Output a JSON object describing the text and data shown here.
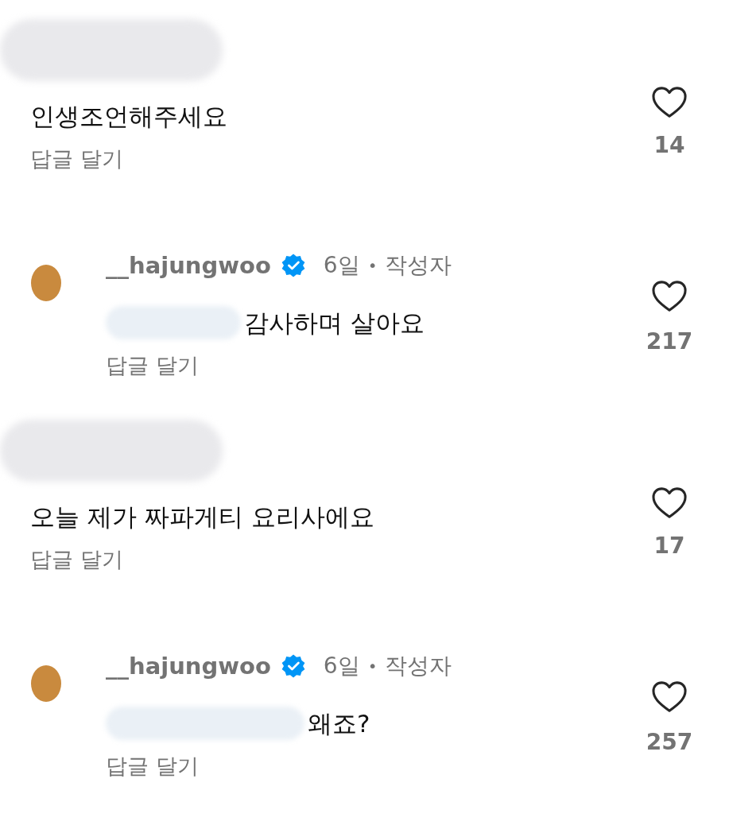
{
  "comments": [
    {
      "kind": "comment",
      "text": "인생조언해주세요",
      "reply_label": "답글 달기",
      "likes": "14",
      "liked": false
    },
    {
      "kind": "reply",
      "username": "__hajungwoo",
      "verified": true,
      "time": "6일",
      "separator": "•",
      "badge": "작성자",
      "text": "감사하며 살아요",
      "reply_label": "답글 달기",
      "likes": "217",
      "liked": false
    },
    {
      "kind": "comment",
      "text": "오늘 제가 짜파게티 요리사에요",
      "reply_label": "답글 달기",
      "likes": "17",
      "liked": false
    },
    {
      "kind": "reply",
      "username": "__hajungwoo",
      "verified": true,
      "time": "6일",
      "separator": "•",
      "badge": "작성자",
      "text": "왜죠?",
      "reply_label": "답글 달기",
      "likes": "257",
      "liked": false
    }
  ]
}
